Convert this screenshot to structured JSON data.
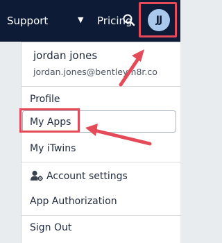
{
  "nav": {
    "support_label": "Support",
    "pricing_label": "Pricing",
    "caret_glyph": "▼",
    "search_icon": "search-icon"
  },
  "user": {
    "initials": "JJ",
    "name": "jordan jones",
    "email": "jordan.jones@bentleym8r.co"
  },
  "menu": {
    "items": [
      {
        "label": "Profile"
      },
      {
        "label": "My Apps"
      },
      {
        "label": "My iTwins"
      },
      {
        "label": "Account settings",
        "icon": "user-gear-icon"
      },
      {
        "label": "App Authorization"
      },
      {
        "label": "Sign Out"
      }
    ]
  },
  "colors": {
    "topbar": "#0d1b36",
    "avatar": "#a9c8ec",
    "annotation": "#e44a57"
  }
}
